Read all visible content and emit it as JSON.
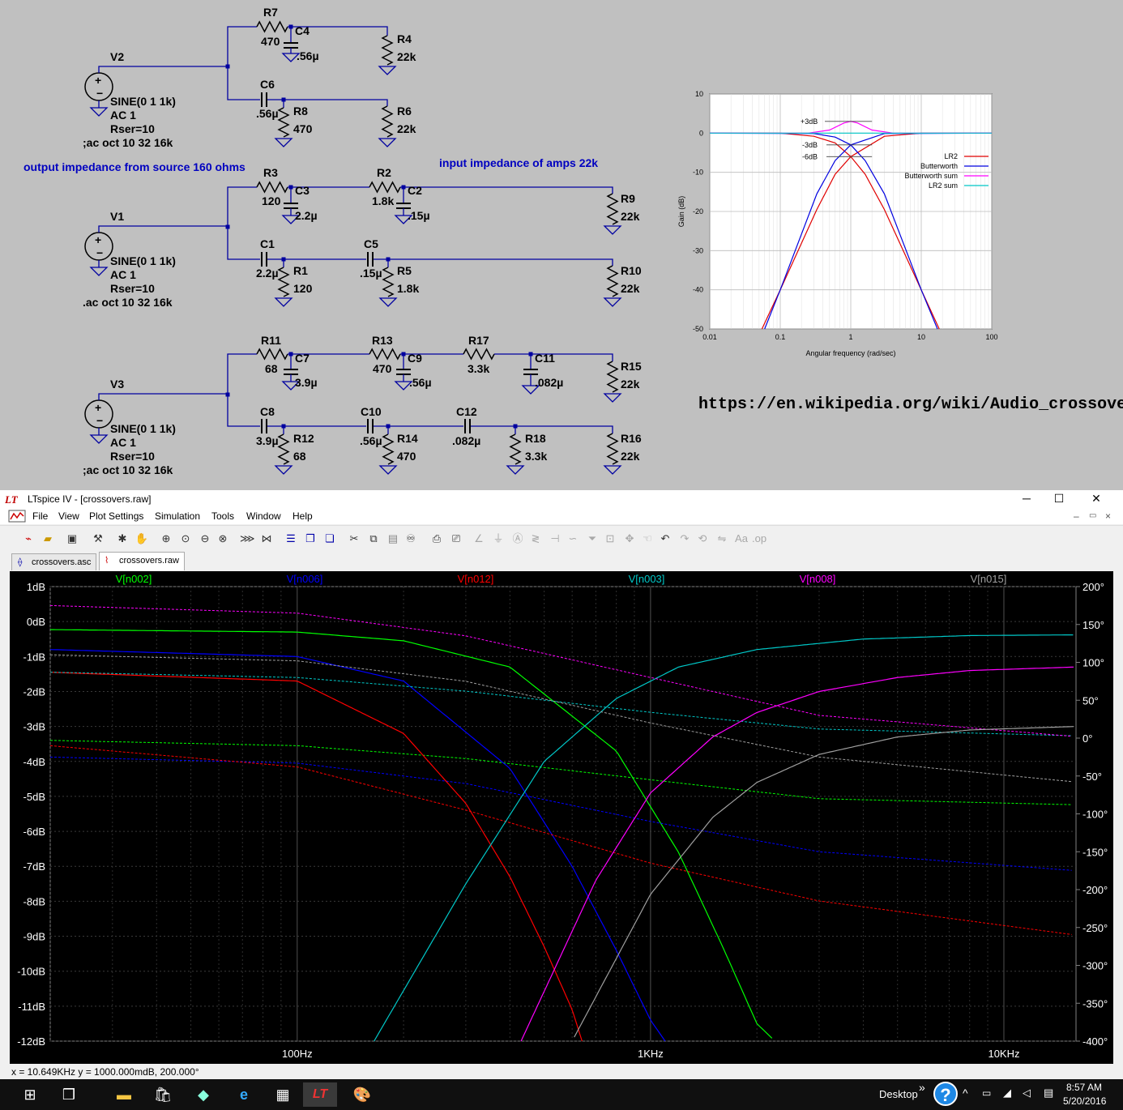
{
  "schematic": {
    "stage1": {
      "source": {
        "name": "V2",
        "spec1": "SINE(0 1 1k)",
        "spec2": "AC 1",
        "spec3": "Rser=10",
        "directive": ";ac oct 10 32 16k"
      },
      "R7": {
        "name": "R7",
        "value": "470"
      },
      "C4": {
        "name": "C4",
        "value": ".56µ"
      },
      "R4": {
        "name": "R4",
        "value": "22k"
      },
      "C6": {
        "name": "C6",
        "value": ".56µ"
      },
      "R8": {
        "name": "R8",
        "value": "470"
      },
      "R6": {
        "name": "R6",
        "value": "22k"
      }
    },
    "stage2": {
      "source": {
        "name": "V1",
        "spec1": "SINE(0 1 1k)",
        "spec2": "AC 1",
        "spec3": "Rser=10",
        "directive": ".ac oct 10 32 16k"
      },
      "R3": {
        "name": "R3",
        "value": "120"
      },
      "C3": {
        "name": "C3",
        "value": "2.2µ"
      },
      "R2": {
        "name": "R2",
        "value": "1.8k"
      },
      "C2": {
        "name": "C2",
        "value": ".15µ"
      },
      "R9": {
        "name": "R9",
        "value": "22k"
      },
      "C1": {
        "name": "C1",
        "value": "2.2µ"
      },
      "R1": {
        "name": "R1",
        "value": "120"
      },
      "C5": {
        "name": "C5",
        "value": ".15µ"
      },
      "R5": {
        "name": "R5",
        "value": "1.8k"
      },
      "R10": {
        "name": "R10",
        "value": "22k"
      }
    },
    "stage3": {
      "source": {
        "name": "V3",
        "spec1": "SINE(0 1 1k)",
        "spec2": "AC 1",
        "spec3": "Rser=10",
        "directive": ";ac oct 10 32 16k"
      },
      "R11": {
        "name": "R11",
        "value": "68"
      },
      "C7": {
        "name": "C7",
        "value": "3.9µ"
      },
      "R13": {
        "name": "R13",
        "value": "470"
      },
      "C9": {
        "name": "C9",
        "value": ".56µ"
      },
      "R17": {
        "name": "R17",
        "value": "3.3k"
      },
      "C11": {
        "name": "C11",
        "value": ".082µ"
      },
      "R15": {
        "name": "R15",
        "value": "22k"
      },
      "C8": {
        "name": "C8",
        "value": "3.9µ"
      },
      "R12": {
        "name": "R12",
        "value": "68"
      },
      "C10": {
        "name": "C10",
        "value": ".56µ"
      },
      "R14": {
        "name": "R14",
        "value": "470"
      },
      "C12": {
        "name": "C12",
        "value": ".082µ"
      },
      "R18": {
        "name": "R18",
        "value": "3.3k"
      },
      "R16": {
        "name": "R16",
        "value": "22k"
      }
    },
    "note_output_impedance": "output impedance from source 160 ohms",
    "note_input_impedance": "input impedance of amps 22k",
    "wiki_url": "https://en.wikipedia.org/wiki/Audio_crossover"
  },
  "chart_data": [
    {
      "type": "line",
      "title": "",
      "xlabel": "Angular frequency (rad/sec)",
      "ylabel": "Gain (dB)",
      "x_scale": "log",
      "xlim": [
        0.01,
        100
      ],
      "ylim": [
        -50,
        10
      ],
      "x_ticks": [
        "0.01",
        "0.1",
        "1",
        "10",
        "100"
      ],
      "y_ticks": [
        "10",
        "0",
        "-10",
        "-20",
        "-30",
        "-40",
        "-50"
      ],
      "grid": true,
      "legend_position": "right",
      "annotations": [
        "+3dB",
        "-3dB",
        "-6dB"
      ],
      "series": [
        {
          "name": "LR2",
          "color": "#e00000",
          "low_x": [
            0.01,
            0.1,
            0.3,
            0.6,
            1,
            1.6,
            3,
            10,
            18
          ],
          "low_y": [
            0,
            0,
            -0.8,
            -2.5,
            -6,
            -10.5,
            -19.5,
            -40,
            -50
          ],
          "high_x": [
            0.055,
            0.1,
            0.33,
            0.6,
            1,
            3,
            10,
            100
          ],
          "high_y": [
            -50,
            -40,
            -19.5,
            -10.5,
            -6,
            -0.8,
            0,
            0
          ]
        },
        {
          "name": "Butterworth",
          "color": "#0000e0",
          "low_x": [
            0.01,
            0.3,
            0.6,
            1,
            1.6,
            3,
            10,
            17
          ],
          "low_y": [
            0,
            -0.1,
            -1,
            -3,
            -7,
            -15.5,
            -40,
            -50
          ],
          "high_x": [
            0.06,
            0.1,
            0.33,
            0.6,
            1,
            3,
            100
          ],
          "high_y": [
            -50,
            -40,
            -15.5,
            -7,
            -3,
            -0.1,
            0
          ]
        },
        {
          "name": "Butterworth sum",
          "color": "#ff00ff",
          "x": [
            0.01,
            0.25,
            0.5,
            0.8,
            1,
            1.25,
            2,
            4,
            100
          ],
          "y": [
            0,
            0,
            0.8,
            2.6,
            3,
            2.6,
            0.8,
            0,
            0
          ]
        },
        {
          "name": "LR2 sum",
          "color": "#00c8c8",
          "x": [
            0.01,
            100
          ],
          "y": [
            0,
            0
          ]
        }
      ]
    },
    {
      "type": "line",
      "title": "",
      "xlabel": "",
      "ylabel": "",
      "x_scale": "log",
      "xlim": [
        20,
        16000
      ],
      "ylim_left_db": [
        -12,
        1
      ],
      "ylim_right_deg": [
        -400,
        200
      ],
      "x_ticks": [
        "100Hz",
        "1KHz",
        "10KHz"
      ],
      "y_ticks_left": [
        "1dB",
        "0dB",
        "-1dB",
        "-2dB",
        "-3dB",
        "-4dB",
        "-5dB",
        "-6dB",
        "-7dB",
        "-8dB",
        "-9dB",
        "-10dB",
        "-11dB",
        "-12dB"
      ],
      "y_ticks_right": [
        "200°",
        "150°",
        "100°",
        "50°",
        "0°",
        "-50°",
        "-100°",
        "-150°",
        "-200°",
        "-250°",
        "-300°",
        "-350°",
        "-400°"
      ],
      "grid": true,
      "series": [
        {
          "name": "V[n002]",
          "color": "#00ff00",
          "mag_x": [
            20,
            100,
            200,
            400,
            800,
            1200,
            1600,
            2000,
            2250
          ],
          "mag_db": [
            -0.23,
            -0.3,
            -0.55,
            -1.3,
            -3.7,
            -6.6,
            -9.3,
            -11.5,
            -12
          ],
          "phase_x": [
            20,
            100,
            300,
            1000,
            3000,
            16000
          ],
          "phase_deg": [
            -3,
            -10,
            -27,
            -55,
            -80,
            -88
          ]
        },
        {
          "name": "V[n006]",
          "color": "#0000ff",
          "mag_x": [
            20,
            100,
            200,
            400,
            600,
            800,
            1000,
            1100
          ],
          "mag_db": [
            -0.8,
            -1.0,
            -1.7,
            -4.2,
            -7.0,
            -9.4,
            -11.4,
            -12
          ],
          "phase_x": [
            20,
            100,
            300,
            1000,
            3000,
            16000
          ],
          "phase_deg": [
            -25,
            -33,
            -60,
            -110,
            -150,
            -175
          ]
        },
        {
          "name": "V[n012]",
          "color": "#ff0000",
          "mag_x": [
            20,
            100,
            200,
            300,
            400,
            500,
            600,
            640
          ],
          "mag_db": [
            -1.45,
            -1.7,
            -3.2,
            -5.2,
            -7.3,
            -9.3,
            -11.1,
            -12
          ],
          "phase_x": [
            20,
            100,
            300,
            1000,
            3000,
            16000
          ],
          "phase_deg": [
            -10,
            -38,
            -95,
            -165,
            -215,
            -260
          ]
        },
        {
          "name": "V[n003]",
          "color": "#00c8c8",
          "mag_x": [
            165,
            300,
            500,
            800,
            1200,
            2000,
            4000,
            8000,
            16000
          ],
          "mag_db": [
            -12,
            -7.5,
            -4.0,
            -2.2,
            -1.3,
            -0.8,
            -0.5,
            -0.4,
            -0.38
          ],
          "phase_x": [
            20,
            100,
            300,
            1000,
            3000,
            16000
          ],
          "phase_deg": [
            87,
            80,
            62,
            34,
            12,
            3
          ]
        },
        {
          "name": "V[n008]",
          "color": "#ff00ff",
          "mag_x": [
            430,
            700,
            1000,
            1500,
            2000,
            3000,
            5000,
            8000,
            16000
          ],
          "mag_db": [
            -12,
            -7.4,
            -4.9,
            -3.3,
            -2.6,
            -2.0,
            -1.6,
            -1.4,
            -1.3
          ],
          "phase_x": [
            20,
            100,
            300,
            1000,
            3000,
            16000
          ],
          "phase_deg": [
            175,
            165,
            135,
            80,
            30,
            2
          ]
        },
        {
          "name": "V[n015]",
          "color": "#a0a0a0",
          "mag_x": [
            600,
            1000,
            1500,
            2000,
            3000,
            5000,
            8000,
            16000
          ],
          "mag_db": [
            -12,
            -7.8,
            -5.6,
            -4.6,
            -3.8,
            -3.3,
            -3.1,
            -3.0
          ],
          "phase_x": [
            20,
            100,
            300,
            1000,
            3000,
            16000
          ],
          "phase_deg": [
            110,
            102,
            75,
            20,
            -25,
            -58
          ]
        }
      ]
    }
  ],
  "ltspice": {
    "title": "LTspice IV - [crossovers.raw]",
    "menu": [
      "File",
      "View",
      "Plot Settings",
      "Simulation",
      "Tools",
      "Window",
      "Help"
    ],
    "tabs": [
      "crossovers.asc",
      "crossovers.raw"
    ],
    "status": "x = 10.649KHz    y = 1000.000mdB, 200.000°",
    "window_buttons": {
      "minimize": "─",
      "maximize": "☐",
      "close": "✕"
    }
  },
  "taskbar": {
    "desktop_label": "Desktop",
    "help_label": "?",
    "time": "8:57 AM",
    "date": "5/20/2016",
    "overflow_label": "»",
    "tray_icons": [
      "chevron-up-icon",
      "battery-icon",
      "wifi-icon",
      "volume-icon",
      "notification-icon"
    ]
  }
}
